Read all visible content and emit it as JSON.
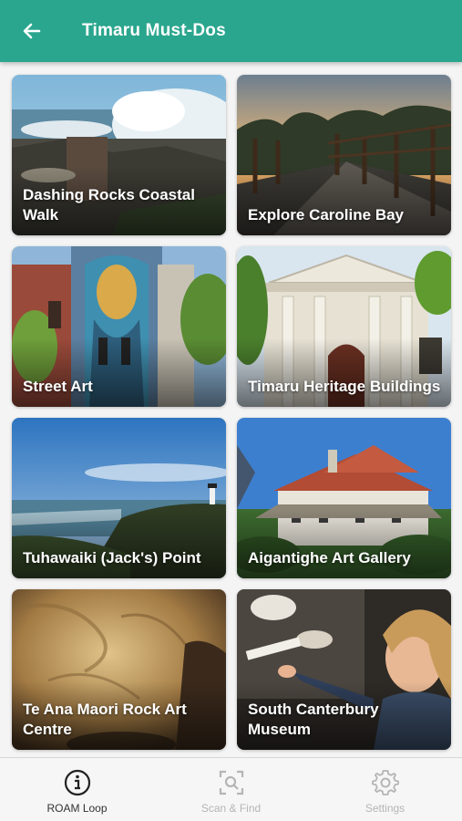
{
  "header": {
    "title": "Timaru Must-Dos",
    "back_icon": "arrow-left-icon",
    "background": "#2aa68e"
  },
  "cards": [
    {
      "label": "Dashing Rocks Coastal Walk",
      "image": "coastal-waves-rocks"
    },
    {
      "label": "Explore Caroline Bay",
      "image": "boardwalk-sunset"
    },
    {
      "label": "Street Art",
      "image": "mural-building"
    },
    {
      "label": "Timaru Heritage Buildings",
      "image": "heritage-building"
    },
    {
      "label": "Tuhawaiki (Jack's) Point",
      "image": "coastal-lighthouse"
    },
    {
      "label": "Aigantighe Art Gallery",
      "image": "historic-house"
    },
    {
      "label": "Te Ana Maori Rock Art Centre",
      "image": "rock-cave"
    },
    {
      "label": "South Canterbury Museum",
      "image": "museum-child"
    }
  ],
  "bottom_nav": {
    "items": [
      {
        "label": "ROAM Loop",
        "icon": "info-circle-icon",
        "active": true
      },
      {
        "label": "Scan & Find",
        "icon": "scan-search-icon",
        "active": false
      },
      {
        "label": "Settings",
        "icon": "gear-icon",
        "active": false
      }
    ]
  },
  "colors": {
    "accent": "#2aa68e",
    "nav_active": "#333333",
    "nav_inactive": "#b5b5b5"
  }
}
